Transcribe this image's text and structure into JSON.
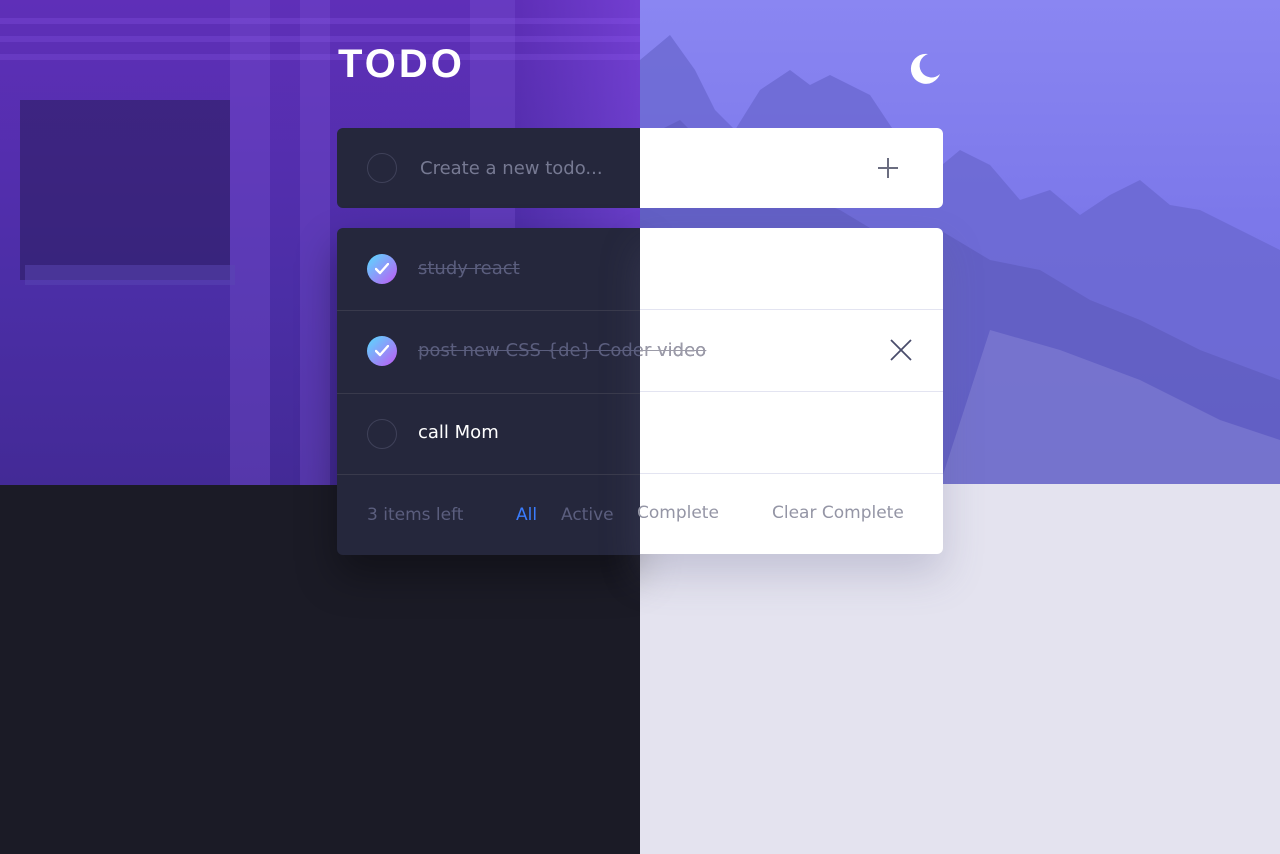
{
  "header": {
    "title": "TODO",
    "theme_icon": "moon-icon"
  },
  "new_todo": {
    "placeholder": "Create a new todo...",
    "value": "",
    "add_icon": "plus-icon"
  },
  "todos": [
    {
      "text": "study react",
      "completed": true
    },
    {
      "text": "post new CSS {de} Coder video",
      "completed": true
    },
    {
      "text": "call Mom",
      "completed": false
    }
  ],
  "footer": {
    "items_left": "3 items left",
    "filters": [
      "All",
      "Active",
      "Complete"
    ],
    "active_filter": "All",
    "clear_label": "Clear Complete"
  },
  "colors": {
    "dark_panel": "#25273c",
    "light_panel": "#ffffff",
    "accent": "#3a7cfd",
    "check_gradient": [
      "#57ddff",
      "#c058f3"
    ]
  }
}
